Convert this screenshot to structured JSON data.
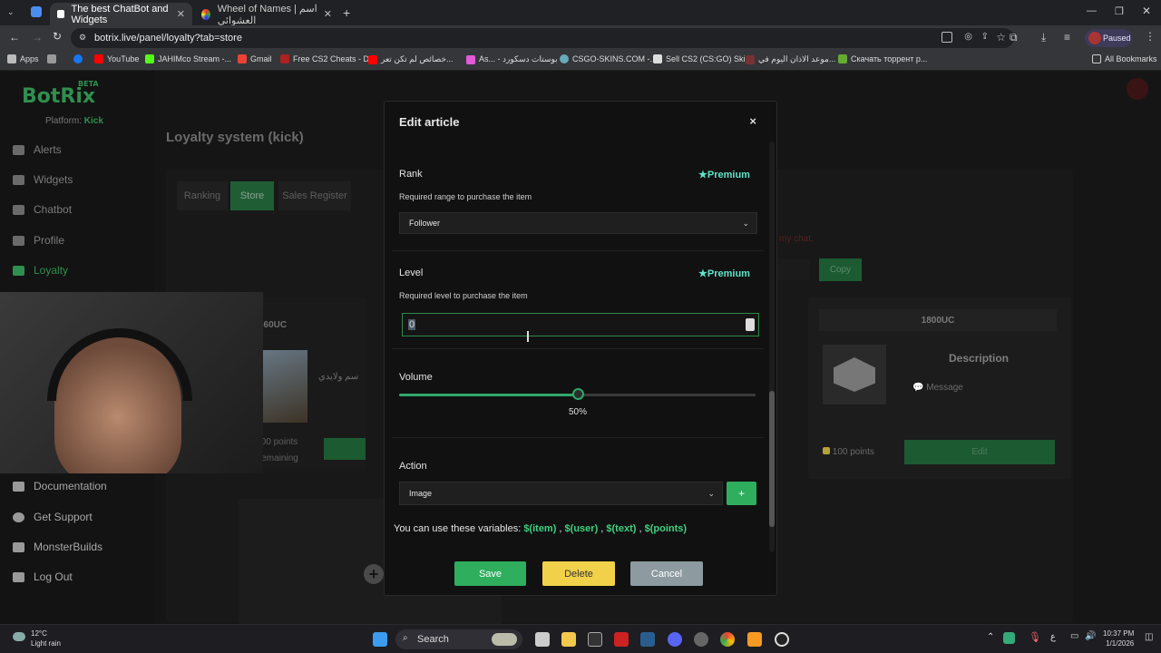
{
  "browser": {
    "tabs": [
      {
        "label": "The best ChatBot and Widgets",
        "active": true
      },
      {
        "label": "Wheel of Names | اسم العشوائي",
        "active": false
      }
    ],
    "url": "botrix.live/panel/loyalty?tab=store",
    "profile_status": "Paused",
    "bookmarks": [
      "Apps",
      "YouTube",
      "JAHIMco Stream -...",
      "Gmail",
      "Free CS2 Cheats - D...",
      "خصائص لم تكن تعر...",
      "As... - بوستات دسكورد",
      "CSGO-SKINS.COM -...",
      "Sell CS2 (CS:GO) Ski...",
      "موعد الاذان اليوم في...",
      "Скачать торрент р..."
    ],
    "all_bookmarks": "All Bookmarks"
  },
  "app": {
    "logo": "BotRix",
    "beta": "BETA",
    "platform_label": "Platform:",
    "platform_value": "Kick",
    "nav": [
      "Alerts",
      "Widgets",
      "Chatbot",
      "Profile",
      "Loyalty"
    ],
    "nav_bottom": [
      "Documentation",
      "Get Support",
      "MonsterBuilds",
      "Log Out"
    ],
    "page_title": "Loyalty system (kick)",
    "tabs": [
      "Ranking",
      "Store",
      "Sales Register"
    ],
    "notice": "my chat.",
    "copy_label": "Copy",
    "items": [
      {
        "title": "660UC",
        "text": "سم ولايدي",
        "points": "8,000 points",
        "remaining": "20remaining"
      },
      {
        "title": "1800UC",
        "description_label": "Description",
        "message_label": "Message",
        "points": "100 points",
        "action": "Edit"
      }
    ]
  },
  "modal": {
    "title": "Edit article",
    "close": "×",
    "rank_label": "Rank",
    "rank_premium": "Premium",
    "rank_hint": "Required range to purchase the item",
    "rank_value": "Follower",
    "level_label": "Level",
    "level_premium": "Premium",
    "level_hint": "Required level to purchase the item",
    "level_value": "0",
    "volume_label": "Volume",
    "volume_percent": 50,
    "volume_text": "50%",
    "action_label": "Action",
    "action_value": "Image",
    "add_label": "+",
    "vars_prefix": "You can use these variables:",
    "vars": [
      "$(item)",
      "$(user)",
      "$(text)",
      "$(points)"
    ],
    "save": "Save",
    "delete": "Delete",
    "cancel": "Cancel"
  },
  "taskbar": {
    "weather_temp": "12°C",
    "weather_desc": "Light rain",
    "search": "Search",
    "lang": "ع",
    "time": "10:37 PM",
    "date": "1/1/2026"
  },
  "colors": {
    "accent": "#2fae5e",
    "premium": "#5fe3c8",
    "delete": "#f2d14a",
    "cancel": "#8d9aa0"
  }
}
